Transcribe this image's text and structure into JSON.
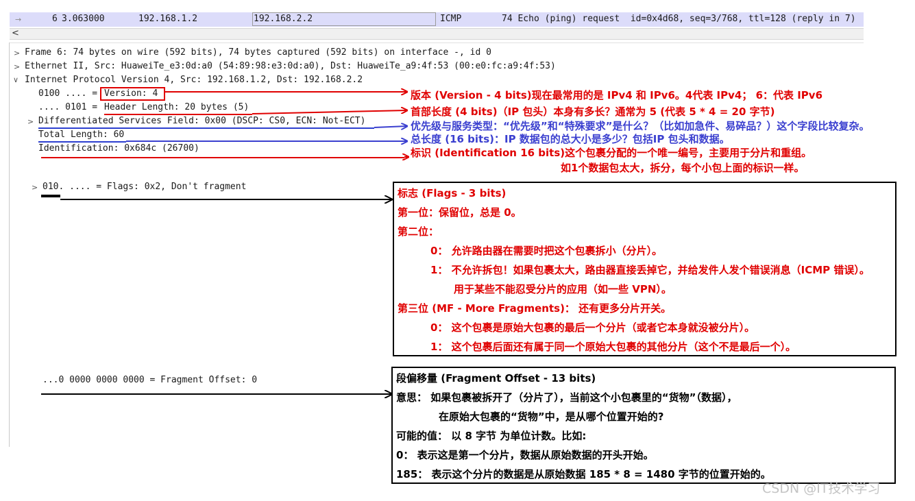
{
  "packet_list": {
    "row": {
      "no": "6",
      "time": "3.063000",
      "source": "192.168.1.2",
      "destination": "192.168.2.2",
      "protocol": "ICMP",
      "info": "74 Echo (ping) request  id=0x4d68, seq=3/768, ttl=128 (reply in 7)"
    }
  },
  "scrollbar": {
    "left_arrow": "<"
  },
  "details": {
    "frame": "Frame 6: 74 bytes on wire (592 bits), 74 bytes captured (592 bits) on interface -, id 0",
    "ethernet": "Ethernet II, Src: HuaweiTe_e3:0d:a0 (54:89:98:e3:0d:a0), Dst: HuaweiTe_a9:4f:53 (00:e0:fc:a9:4f:53)",
    "ip": "Internet Protocol Version 4, Src: 192.168.1.2, Dst: 192.168.2.2",
    "version_bits": "0100 .... = ",
    "version_field": "Version: 4",
    "hlen_bits": ".... 0101 = ",
    "hlen_field": "Header Length: 20 bytes (5)",
    "dsfield": "Differentiated Services Field: 0x00 (DSCP: CS0, ECN: Not-ECT)",
    "total_length": "Total Length: 60",
    "identification": "Identification: 0x684c (26700)",
    "flags": "010. .... = Flags: 0x2, Don't fragment",
    "fragment_offset": "...0 0000 0000 0000 = Fragment Offset: 0"
  },
  "annotations": {
    "version": "版本 (Version - 4 bits)现在最常用的是 IPv4 和 IPv6。4代表 IPv4；  6：代表 IPv6",
    "header_length": "首部长度 (4 bits)（IP 包头）本身有多长？通常为 5 (代表 5 * 4 = 20 字节)",
    "dsfield": "优先级与服务类型：“优先级”和“特殊要求”是什么？（比如加急件、易碎品？）这个字段比较复杂。",
    "total_length": "总长度 (16 bits)：IP 数据包的总大小是多少？包括IP 包头和数据。",
    "identification_1": "标识 (Identification 16 bits)这个包裹分配的一个唯一编号，主要用于分片和重组。",
    "identification_2": "如1个数据包太大，拆分，每个小包上面的标识一样。"
  },
  "flags_box": {
    "title": "标志 (Flags - 3 bits)",
    "bit1": "第一位：保留位，总是 0。",
    "bit2": "第二位：",
    "bit2_0": "0： 允许路由器在需要时把这个包裹拆小（分片）。",
    "bit2_1a": "1： 不允许拆包！如果包裹太大，路由器直接丢掉它，并给发件人发个错误消息（ICMP 错误）。",
    "bit2_1b": "用于某些不能忍受分片的应用（如一些 VPN）。",
    "bit3": "第三位 (MF - More Fragments)： 还有更多分片开关。",
    "bit3_0": "0： 这个包裹是原始大包裹的最后一个分片（或者它本身就没被分片）。",
    "bit3_1": "1： 这个包裹后面还有属于同一个原始大包裹的其他分片（这个不是最后一个）。"
  },
  "offset_box": {
    "title": "段偏移量 (Fragment Offset - 13 bits)",
    "meaning_1": "意思： 如果包裹被拆开了（分片了），当前这个小包裹里的“货物”（数据），",
    "meaning_2": "在原始大包裹的“货物”中，是从哪个位置开始的?",
    "values": "可能的值： 以 8 字节 为单位计数。比如:",
    "v0": "0： 表示这是第一个分片，数据从原始数据的开头开始。",
    "v185": "185： 表示这个分片的数据是从原始数据 185 * 8 = 1480 字节的位置开始的。"
  },
  "watermark": "CSDN @IT技术学习",
  "colors": {
    "red": "#e00000",
    "blue": "#3a3fcf",
    "row_bg": "#dcdcfa"
  }
}
